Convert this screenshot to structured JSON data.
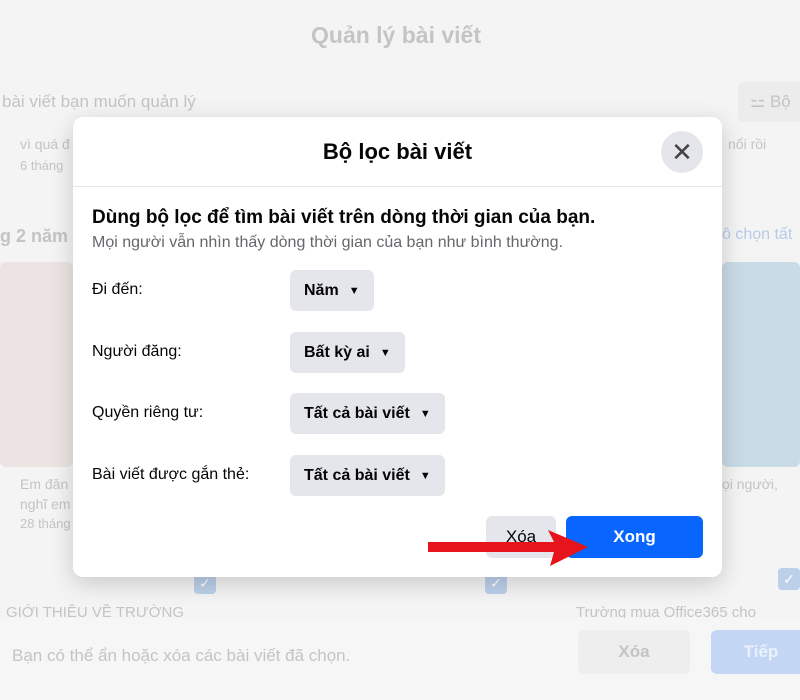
{
  "background": {
    "page_title": "Quản lý bài viết",
    "search_hint": "bài viết bạn muốn quản lý",
    "filter_button": "Bộ",
    "post1_text": "vì quá đ",
    "post1_time": "6 tháng",
    "post2_text": "nổi rồi",
    "section_label": "g 2 năm",
    "select_all": "ô chọn tất",
    "post3_text": "Em đăn",
    "post3_text2": "nghĩ em",
    "post3_time": "28 tháng",
    "post4_text": "ọi người,",
    "card1_caption": "GIỚI THIỆU VỀ TRƯỜNG",
    "card3_caption": "Trường mua Office365 cho",
    "bottom_hint": "Bạn có thể ẩn hoặc xóa các bài viết đã chọn.",
    "delete_button": "Xóa",
    "next_button": "Tiếp"
  },
  "modal": {
    "title": "Bộ lọc bài viết",
    "close_icon": "close-icon",
    "heading": "Dùng bộ lọc để tìm bài viết trên dòng thời gian của bạn.",
    "subheading": "Mọi người vẫn nhìn thấy dòng thời gian của bạn như bình thường.",
    "filters": [
      {
        "label": "Đi đến:",
        "value": "Năm"
      },
      {
        "label": "Người đăng:",
        "value": "Bất kỳ ai"
      },
      {
        "label": "Quyền riêng tư:",
        "value": "Tất cả bài viết"
      },
      {
        "label": "Bài viết được gắn thẻ:",
        "value": "Tất cả bài viết"
      }
    ],
    "clear_button": "Xóa",
    "done_button": "Xong"
  },
  "colors": {
    "primary": "#0866ff",
    "annotation_arrow": "#e8141b"
  }
}
